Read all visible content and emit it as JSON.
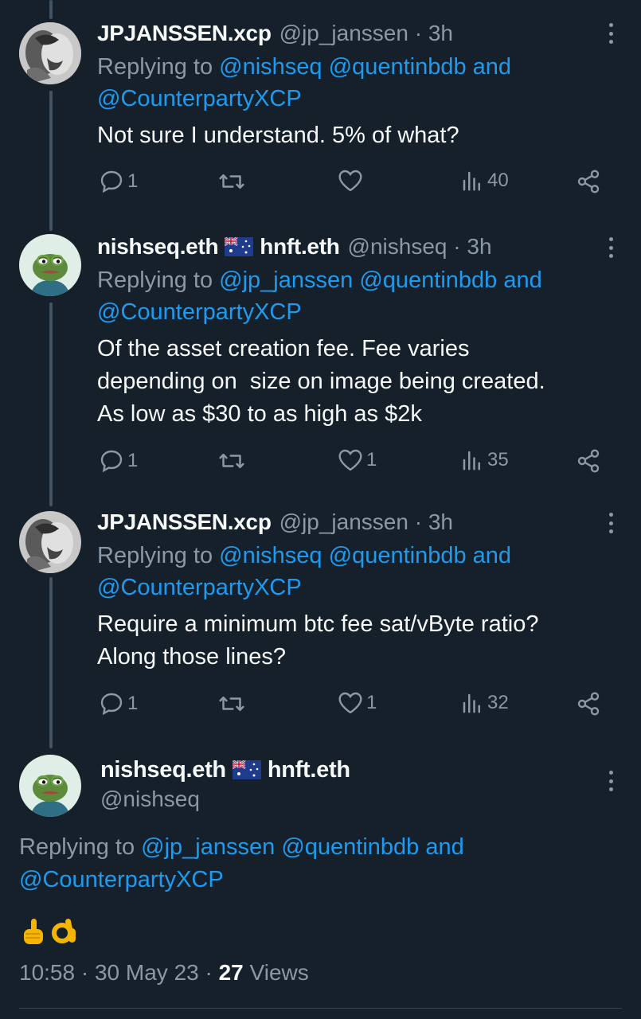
{
  "tweets": [
    {
      "name": "JPJANSSEN.xcp",
      "handle": "@jp_janssen",
      "time": "3h",
      "replying_prefix": "Replying to",
      "mentions": [
        "@nishseq",
        "@quentinbdb",
        "and",
        "@CounterpartyXCP"
      ],
      "text": "Not sure I understand. 5% of what?",
      "reply_count": "1",
      "retweet_count": "",
      "like_count": "",
      "views": "40",
      "avatar_icon": "bw-portrait-avatar"
    },
    {
      "name": "nishseq.eth",
      "name_suffix": "hnft.eth",
      "handle": "@nishseq",
      "time": "3h",
      "replying_prefix": "Replying to",
      "mentions": [
        "@jp_janssen",
        "@quentinbdb",
        "and",
        "@CounterpartyXCP"
      ],
      "text_lines": [
        "Of the asset creation fee. Fee varies",
        "depending on  size on image being created.",
        "As low as $30 to as high as $2k"
      ],
      "reply_count": "1",
      "retweet_count": "",
      "like_count": "1",
      "views": "35",
      "avatar_icon": "pepe-frog-avatar"
    },
    {
      "name": "JPJANSSEN.xcp",
      "handle": "@jp_janssen",
      "time": "3h",
      "replying_prefix": "Replying to",
      "mentions": [
        "@nishseq",
        "@quentinbdb",
        "and",
        "@CounterpartyXCP"
      ],
      "text_lines": [
        "Require a minimum btc fee sat/vByte ratio?",
        "Along those lines?"
      ],
      "reply_count": "1",
      "retweet_count": "",
      "like_count": "1",
      "views": "32",
      "avatar_icon": "bw-portrait-avatar"
    }
  ],
  "main_tweet": {
    "name": "nishseq.eth",
    "name_suffix": "hnft.eth",
    "handle": "@nishseq",
    "replying_prefix": "Replying to",
    "mentions": [
      "@jp_janssen",
      "@quentinbdb",
      "and",
      "@CounterpartyXCP"
    ],
    "emojis": [
      "point-up-emoji",
      "ok-hand-emoji"
    ],
    "time": "10:58",
    "date": "30 May 23",
    "views_count": "27",
    "views_label": "Views",
    "separator": "·"
  },
  "colors": {
    "background": "#15202b",
    "text": "#f7f9f9",
    "secondary": "#8b98a5",
    "accent": "#1d9bf0",
    "thread_line": "#425364"
  }
}
